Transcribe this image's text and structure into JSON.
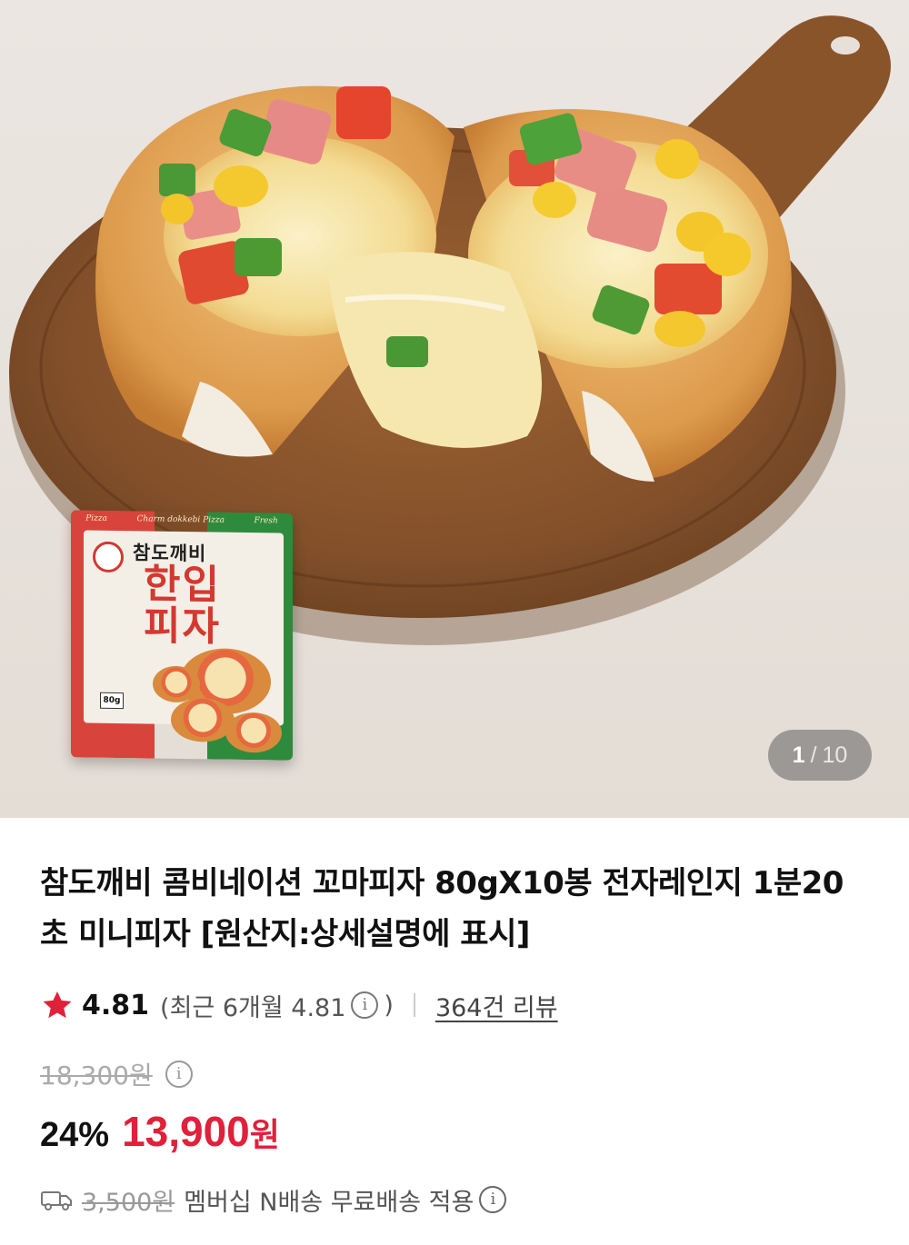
{
  "gallery": {
    "current_page": "1",
    "separator": "/",
    "total_pages": "10",
    "package": {
      "top_text": [
        "Pizza",
        "Charm dokkebi Pizza",
        "Fresh"
      ],
      "brand": "참도깨비",
      "product_line1": "한입",
      "product_line2": "피자",
      "weight_badge": "80g"
    }
  },
  "product": {
    "title": "참도깨비 콤비네이션 꼬마피자 80gX10봉 전자레인지 1분20초 미니피자 [원산지:상세설명에 표시]"
  },
  "rating": {
    "score": "4.81",
    "recent_label": "(최근 6개월 4.81",
    "recent_close": ")",
    "review_link": "364건 리뷰",
    "star_color": "#e1203a"
  },
  "price": {
    "original": "18,300원",
    "discount": "24%",
    "sale_amount": "13,900",
    "sale_unit": "원",
    "sale_color": "#e1203a"
  },
  "shipping": {
    "original_fee": "3,500원",
    "text": "멤버십 N배송 무료배송 적용"
  },
  "icons": {
    "info": "info-circle-icon",
    "star": "star-icon",
    "truck": "truck-icon"
  }
}
